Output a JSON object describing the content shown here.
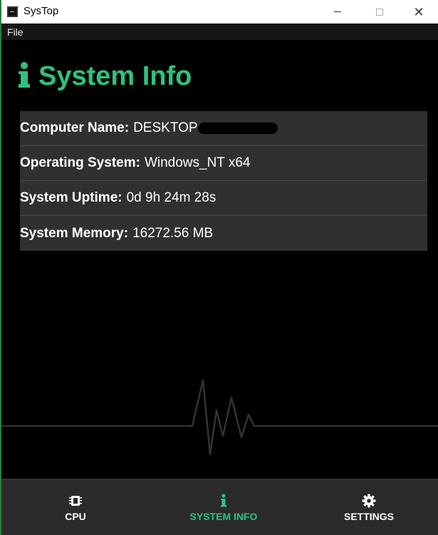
{
  "window": {
    "title": "SysTop",
    "menu": [
      "File"
    ]
  },
  "page": {
    "title": "System Info",
    "accent_color": "#2ec27e"
  },
  "info_rows": [
    {
      "label": "Computer Name:",
      "value": "DESKTOP-"
    },
    {
      "label": "Operating System:",
      "value": "Windows_NT x64"
    },
    {
      "label": "System Uptime:",
      "value": "0d 9h 24m 28s"
    },
    {
      "label": "System Memory:",
      "value": "16272.56 MB"
    }
  ],
  "nav": [
    {
      "label": "CPU",
      "icon": "chip-icon",
      "active": false
    },
    {
      "label": "SYSTEM INFO",
      "icon": "info-icon",
      "active": true
    },
    {
      "label": "SETTINGS",
      "icon": "gear-icon",
      "active": false
    }
  ]
}
